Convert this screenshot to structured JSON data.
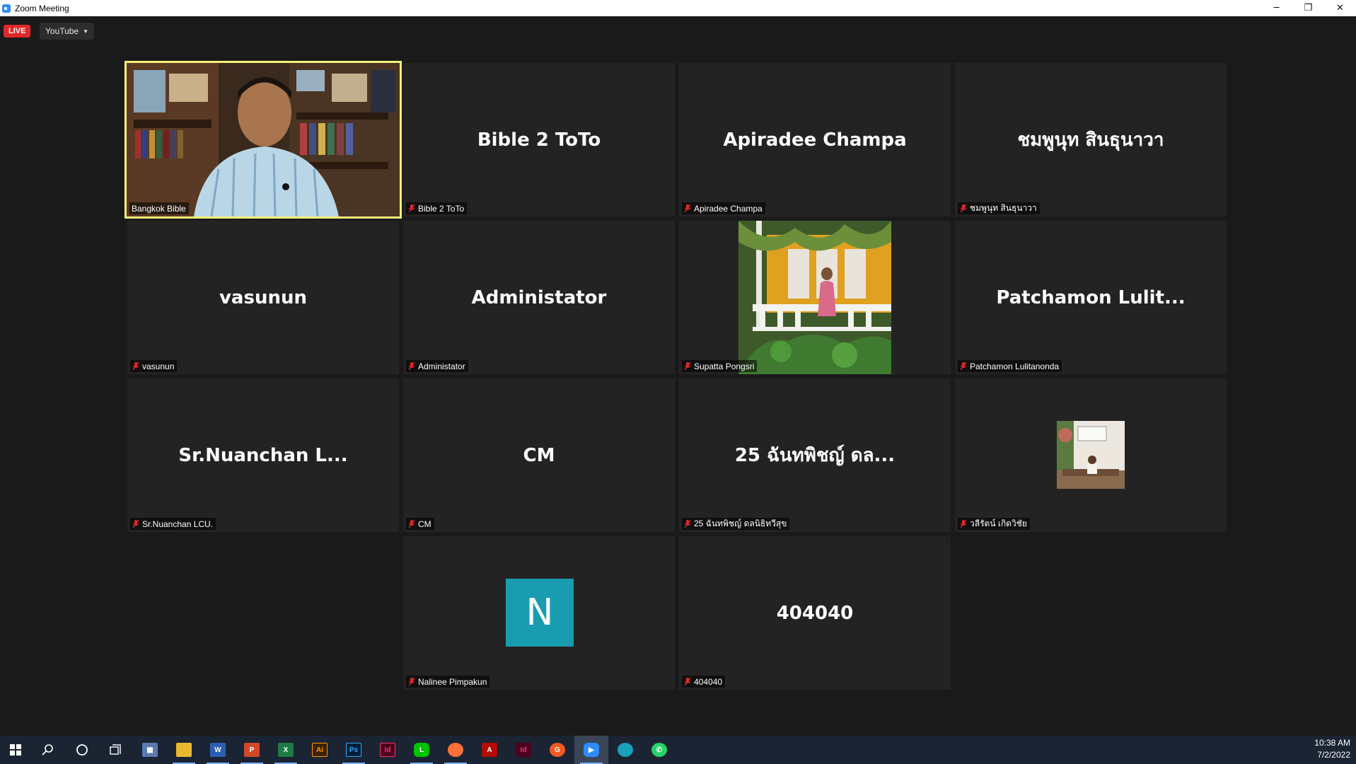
{
  "window": {
    "title": "Zoom Meeting",
    "controls": [
      "─",
      "❐",
      "✕"
    ]
  },
  "toolbar": {
    "live_label": "LIVE",
    "stream_label": "YouTube"
  },
  "tiles": [
    {
      "big": "",
      "label": "Bangkok Bible",
      "muted": false,
      "active": true
    },
    {
      "big": "Bible 2 ToTo",
      "label": "Bible 2 ToTo",
      "muted": true
    },
    {
      "big": "Apiradee Champa",
      "label": "Apiradee Champa",
      "muted": true
    },
    {
      "big": "ชมพูนุท สินธุนาวา",
      "label": "ชมพูนุท สินธุนาวา",
      "muted": true
    },
    {
      "big": "vasunun",
      "label": "vasunun",
      "muted": true
    },
    {
      "big": "Administator",
      "label": "Administator",
      "muted": true
    },
    {
      "big": "",
      "label": "Supatta Pongsri",
      "muted": true
    },
    {
      "big": "Patchamon  Lulit...",
      "label": "Patchamon Lulitanonda",
      "muted": true
    },
    {
      "big": "Sr.Nuanchan    L...",
      "label": "Sr.Nuanchan   LCU.",
      "muted": true
    },
    {
      "big": "CM",
      "label": "CM",
      "muted": true
    },
    {
      "big": "25 ฉันทพิชญ์ ดล...",
      "label": "25 ฉันทพิชญ์ ดลนิธิทวีสุข",
      "muted": true
    },
    {
      "big": "",
      "label": "วลีรัตน์ เกิดวิชัย",
      "muted": true
    },
    {
      "big": "",
      "avatar_letter": "N",
      "label": "Nalinee Pimpakun",
      "muted": true
    },
    {
      "big": "404040",
      "label": "404040",
      "muted": true
    }
  ],
  "colors": {
    "active_border": "#f5f178",
    "avatar_n": "#1a9cb0",
    "live": "#e02828",
    "muted_mic": "#e02828"
  },
  "taskbar": {
    "icons": [
      "windows-start-icon",
      "search-icon",
      "cortana-icon",
      "task-view-icon",
      "calculator-icon",
      "file-explorer-icon",
      "word-icon",
      "powerpoint-icon",
      "excel-icon",
      "illustrator-icon",
      "photoshop-icon",
      "indesign-icon",
      "line-icon",
      "firefox-icon",
      "acrobat-icon",
      "indesign-dark-icon",
      "grammarly-icon",
      "zoom-icon",
      "edge-icon",
      "whatsapp-icon"
    ],
    "time": "10:38 AM",
    "date": "7/2/2022"
  }
}
